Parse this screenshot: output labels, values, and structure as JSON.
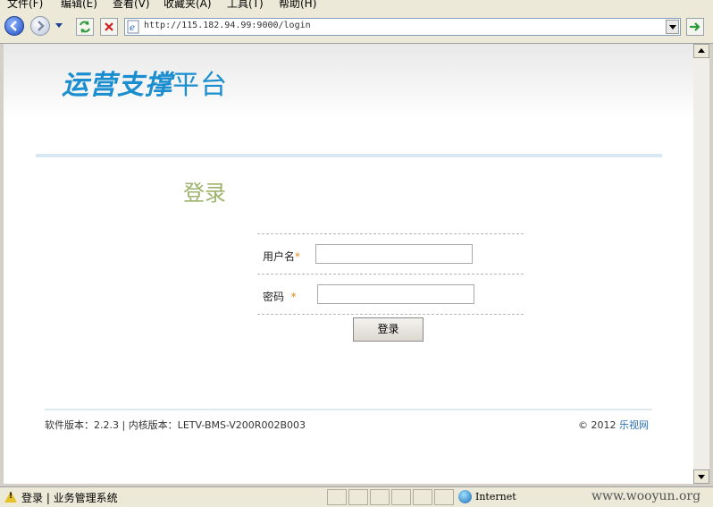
{
  "menu": {
    "items": [
      "文件(F)",
      "编辑(E)",
      "查看(V)",
      "收藏夹(A)",
      "工具(T)",
      "帮助(H)"
    ]
  },
  "address_bar": {
    "url": "http://115.182.94.99:9000/login"
  },
  "page": {
    "logo_bold": "运营支撑",
    "logo_light": "平台",
    "login_title": "登录",
    "form": {
      "username_label": "用户名",
      "password_label": "密码",
      "required_mark": "*",
      "username_value": "",
      "password_value": "",
      "submit_label": "登录"
    },
    "footer": {
      "version_text": "软件版本：2.2.3 | 内核版本：LETV-BMS-V200R002B003",
      "copyright_prefix": "© 2012 ",
      "copyright_link": "乐视网"
    }
  },
  "status_bar": {
    "text": "登录 | 业务管理系统",
    "zone": "Internet",
    "watermark": "www.wooyun.org"
  },
  "colors": {
    "logo_blue": "#1a8ecf",
    "login_title_green": "#9db36c",
    "required_orange": "#e08a1e",
    "link_blue": "#2a6fb5"
  }
}
